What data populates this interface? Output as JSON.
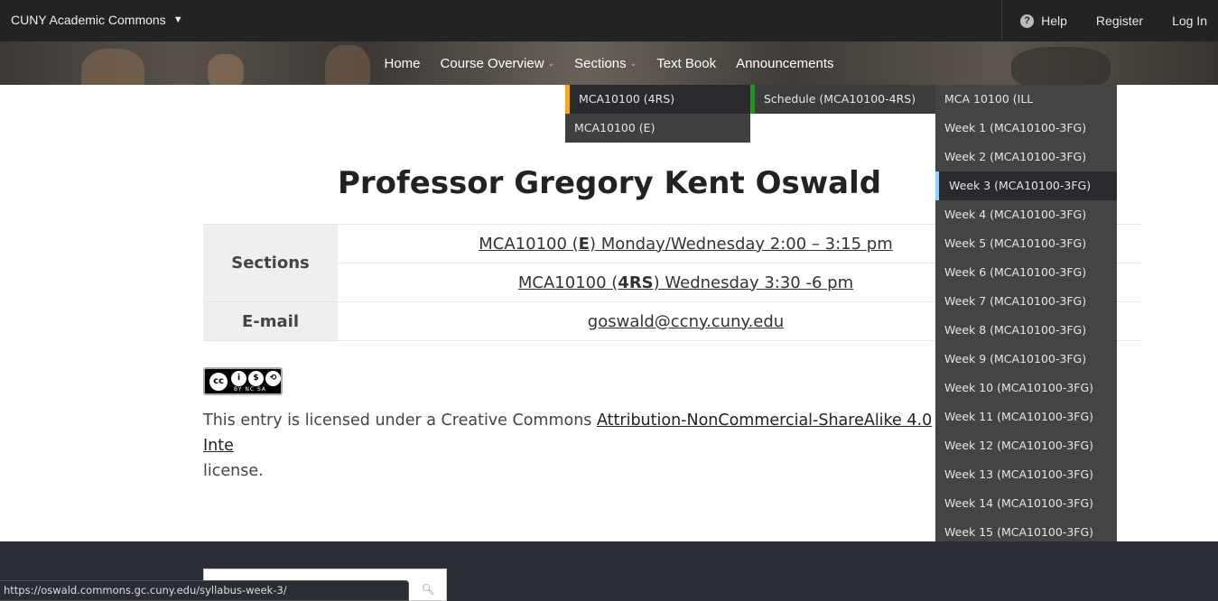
{
  "adminbar": {
    "brand": "CUNY Academic Commons",
    "help": "Help",
    "register": "Register",
    "login": "Log In"
  },
  "nav": {
    "items": [
      "Home",
      "Course Overview",
      "Sections",
      "Text Book",
      "Announcements"
    ]
  },
  "sections_menu": {
    "items": [
      "MCA10100 (4RS)",
      "MCA10100 (E)"
    ],
    "submenu": [
      "Schedule (MCA10100-4RS)"
    ],
    "subsubmenu": [
      "MCA 10100 (ILL",
      "Week 1 (MCA10100-3FG)",
      "Week 2 (MCA10100-3FG)",
      "Week 3 (MCA10100-3FG)",
      "Week 4 (MCA10100-3FG)",
      "Week 5 (MCA10100-3FG)",
      "Week 6 (MCA10100-3FG)",
      "Week 7 (MCA10100-3FG)",
      "Week 8 (MCA10100-3FG)",
      "Week 9 (MCA10100-3FG)",
      "Week 10 (MCA10100-3FG)",
      "Week 11 (MCA10100-3FG)",
      "Week 12 (MCA10100-3FG)",
      "Week 13 (MCA10100-3FG)",
      "Week 14 (MCA10100-3FG)",
      "Week 15 (MCA10100-3FG)"
    ]
  },
  "page": {
    "title": "Professor Gregory Kent Oswald",
    "sections_label": "Sections",
    "email_label": "E-mail",
    "section1": {
      "pre": "MCA10100 (",
      "bold": "E",
      "post": ") Monday/Wednesday 2:00 – 3:15 pm"
    },
    "section2": {
      "pre": "MCA10100 (",
      "bold": "4RS",
      "post": ") Wednesday 3:30 -6 pm"
    },
    "email": "goswald@ccny.cuny.edu",
    "license_pre": "This entry is licensed under a Creative Commons ",
    "license_link": "Attribution-NonCommercial-ShareAlike 4.0 Inte",
    "license_post": "license.",
    "cc_badge_text": "BY NC SA"
  },
  "status_url": "https://oswald.commons.gc.cuny.edu/syllabus-week-3/",
  "colors": {
    "adminbar": "#232323",
    "section_accent": "#f5a623",
    "schedule_accent": "#12a012",
    "active_week_accent": "#8fd2ff",
    "footer": "#2a2d33"
  }
}
